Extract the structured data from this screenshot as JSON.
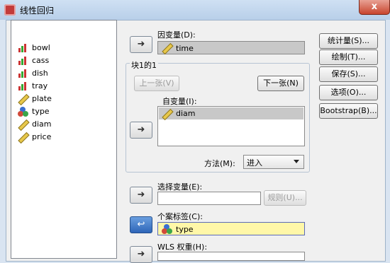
{
  "window": {
    "title": "线性回归",
    "close": "x"
  },
  "variables": [
    {
      "name": "bowl",
      "icon": "nominal-icon"
    },
    {
      "name": "cass",
      "icon": "nominal-icon"
    },
    {
      "name": "dish",
      "icon": "nominal-icon"
    },
    {
      "name": "tray",
      "icon": "nominal-icon"
    },
    {
      "name": "plate",
      "icon": "scale-icon"
    },
    {
      "name": "type",
      "icon": "categorical-icon"
    },
    {
      "name": "diam",
      "icon": "scale-icon"
    },
    {
      "name": "price",
      "icon": "scale-icon"
    }
  ],
  "dependent": {
    "label": "因变量(D):",
    "value": "time"
  },
  "block": {
    "label": "块1的1",
    "prev": "上一张(V)",
    "next": "下一张(N)"
  },
  "independent": {
    "label": "自变量(I):",
    "values": [
      "diam"
    ]
  },
  "method": {
    "label": "方法(M):",
    "value": "进入"
  },
  "selection": {
    "label": "选择变量(E):",
    "value": "",
    "rule": "规则(U)..."
  },
  "case_labels": {
    "label": "个案标签(C):",
    "value": "type"
  },
  "wls": {
    "label": "WLS 权重(H):",
    "value": ""
  },
  "arrows": {
    "glyph": "➜",
    "back_glyph": "↩"
  },
  "side_buttons": {
    "statistics": "统计量(S)...",
    "plots": "绘制(T)...",
    "save": "保存(S)...",
    "options": "选项(O)...",
    "bootstrap": "Bootstrap(B)..."
  }
}
